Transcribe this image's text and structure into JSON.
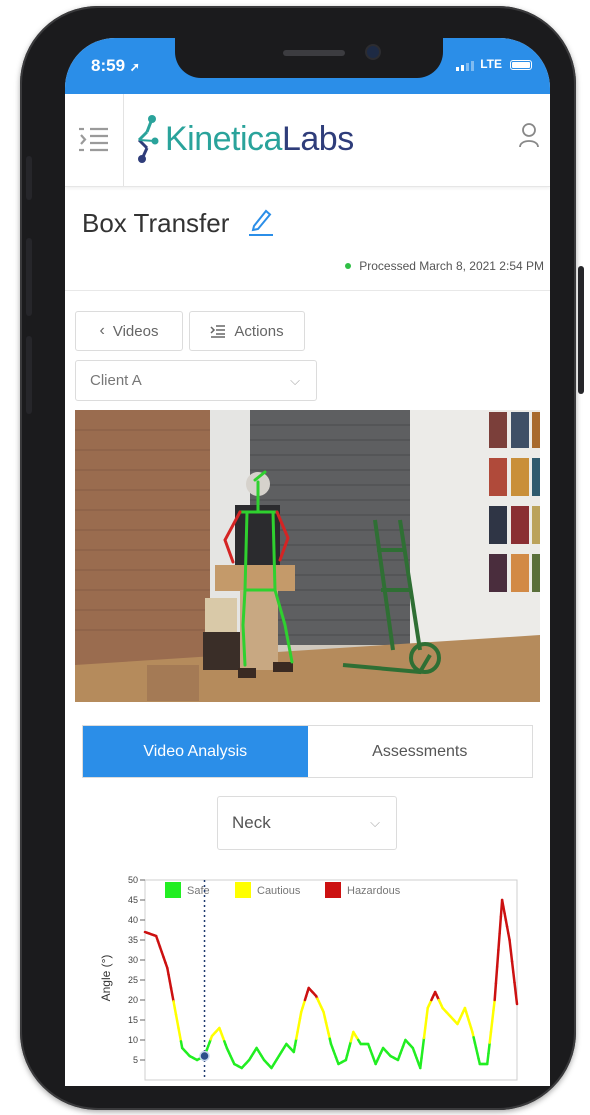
{
  "status_bar": {
    "time": "8:59",
    "carrier": "LTE"
  },
  "app": {
    "brand_part1": "Kinetica",
    "brand_part2": "Labs"
  },
  "page": {
    "title": "Box Transfer",
    "processed": "Processed March 8, 2021 2:54 PM"
  },
  "toolbar": {
    "videos_label": "Videos",
    "actions_label": "Actions"
  },
  "client_select": {
    "value": "Client A"
  },
  "tabs": [
    {
      "label": "Video Analysis",
      "active": true
    },
    {
      "label": "Assessments",
      "active": false
    }
  ],
  "joint_select": {
    "value": "Neck"
  },
  "chart_data": {
    "type": "line",
    "ylabel": "Angle (°)",
    "xlabel": "",
    "ylim": [
      0,
      50
    ],
    "yticks": [
      5,
      10,
      15,
      20,
      25,
      30,
      35,
      40,
      45,
      50
    ],
    "legend": [
      {
        "name": "Safe",
        "color": "#22ee22"
      },
      {
        "name": "Cautious",
        "color": "#ffff00"
      },
      {
        "name": "Hazardous",
        "color": "#cc1111"
      }
    ],
    "zones": {
      "safe_max": 10,
      "cautious_max": 20
    },
    "marker_x": 16,
    "x": [
      0,
      3,
      6,
      8,
      10,
      12,
      14,
      16,
      18,
      20,
      22,
      24,
      26,
      28,
      30,
      32,
      34,
      36,
      38,
      40,
      42,
      44,
      46,
      48,
      50,
      52,
      54,
      56,
      58,
      60,
      62,
      64,
      66,
      68,
      70,
      72,
      74,
      76,
      78,
      80,
      82,
      84,
      86,
      88,
      90,
      92,
      94,
      96,
      98,
      100
    ],
    "y": [
      37,
      36,
      28,
      18,
      8,
      6,
      5,
      6,
      11,
      13,
      8,
      4,
      3,
      5,
      8,
      5,
      3,
      6,
      9,
      7,
      17,
      23,
      21,
      17,
      9,
      4,
      5,
      12,
      9,
      9,
      4,
      8,
      6,
      5,
      10,
      8,
      3,
      18,
      22,
      18,
      16,
      14,
      18,
      12,
      4,
      4,
      20,
      45,
      35,
      19
    ]
  }
}
